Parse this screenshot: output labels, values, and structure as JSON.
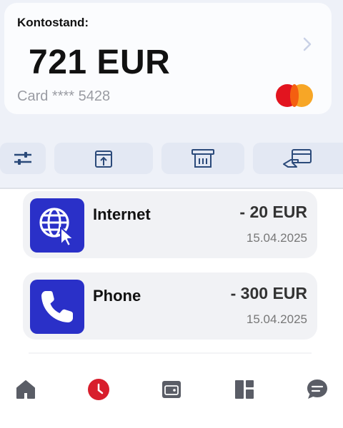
{
  "balance": {
    "label": "Kontostand:",
    "amount": "721 EUR",
    "card_number": "Card **** 5428",
    "card_brand_icon": "mastercard-icon"
  },
  "actions": [
    {
      "icon": "filter-sliders-icon"
    },
    {
      "icon": "upload-tray-icon"
    },
    {
      "icon": "atm-icon"
    },
    {
      "icon": "card-payment-icon"
    }
  ],
  "transactions": [
    {
      "name": "Internet",
      "amount": "- 20 EUR",
      "date": "15.04.2025",
      "icon": "globe-cursor-icon"
    },
    {
      "name": "Phone",
      "amount": "- 300 EUR",
      "date": "15.04.2025",
      "icon": "phone-icon"
    }
  ],
  "nav": [
    {
      "icon": "home-icon",
      "active": false
    },
    {
      "icon": "clock-icon",
      "active": true
    },
    {
      "icon": "wallet-icon",
      "active": false
    },
    {
      "icon": "dashboard-icon",
      "active": false
    },
    {
      "icon": "chat-icon",
      "active": false
    }
  ],
  "colors": {
    "accent": "#2a30c8",
    "active_nav": "#d81e2c",
    "inactive_nav": "#5a5d66",
    "action_icon": "#2b4a7a"
  }
}
